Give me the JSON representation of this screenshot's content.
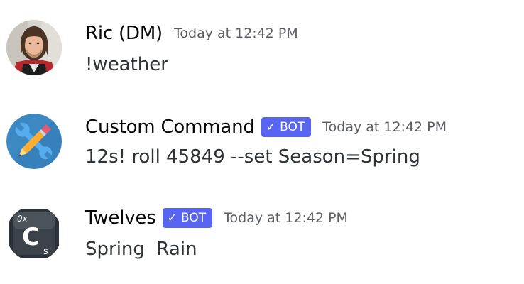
{
  "messages": [
    {
      "username": "Ric (DM)",
      "timestamp": "Today at 12:42 PM",
      "content": "!weather",
      "is_bot": false,
      "avatar": "user-photo"
    },
    {
      "username": "Custom Command",
      "bot_tag": "BOT",
      "timestamp": "Today at 12:42 PM",
      "content": "12s! roll 45849 --set Season=Spring",
      "is_bot": true,
      "avatar": "tools-icon"
    },
    {
      "username": "Twelves",
      "bot_tag": "BOT",
      "timestamp": "Today at 12:42 PM",
      "content": "Spring  Rain",
      "is_bot": true,
      "avatar": "twelves-logo"
    }
  ],
  "colors": {
    "bot_tag_bg": "#5865f2",
    "username": "#060607",
    "timestamp": "#5c5e66",
    "content": "#2e3338"
  },
  "icons": {
    "checkmark": "✓"
  }
}
